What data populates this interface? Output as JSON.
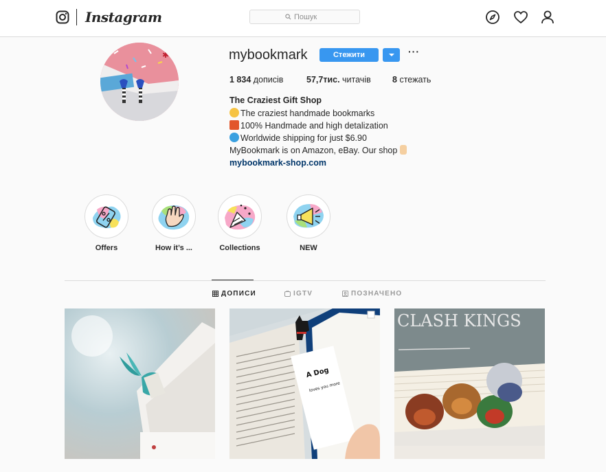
{
  "nav": {
    "wordmark": "Instagram",
    "search_placeholder": "Пошук",
    "icons": [
      "instagram-glyph-icon",
      "search-icon",
      "compass-icon",
      "heart-icon",
      "person-icon"
    ]
  },
  "profile": {
    "username": "mybookmark",
    "follow_label": "Стежити",
    "stats": {
      "posts_count": "1 834",
      "posts_label": "дописів",
      "followers_count": "57,7тис.",
      "followers_label": "читачів",
      "following_count": "8",
      "following_label": "стежать"
    },
    "bio": {
      "name": "The Craziest Gift Shop",
      "lines": [
        "The craziest handmade bookmarks",
        "100% Handmade and high detalization",
        "Worldwide shipping for just $6.90",
        "MyBookmark is on Amazon, eBay. Our shop"
      ],
      "link": "mybookmark-shop.com"
    }
  },
  "highlights": [
    {
      "label": "Offers"
    },
    {
      "label": "How it’s ..."
    },
    {
      "label": "Collections"
    },
    {
      "label": "NEW"
    }
  ],
  "tabs": [
    {
      "label": "ДОПИСИ",
      "active": true
    },
    {
      "label": "IGTV",
      "active": false
    },
    {
      "label": "ПОЗНАЧЕНО",
      "active": false
    }
  ],
  "posts": [
    {
      "image": "fish-tail-bookmark"
    },
    {
      "image": "dog-bookmark-in-book"
    },
    {
      "image": "dragon-bookmarks-clash-of-kings",
      "book_title": "CLASH KINGS"
    }
  ],
  "colors": {
    "accent": "#3897f0",
    "link": "#003569",
    "border": "#dbdbdb",
    "background": "#fafafa"
  }
}
